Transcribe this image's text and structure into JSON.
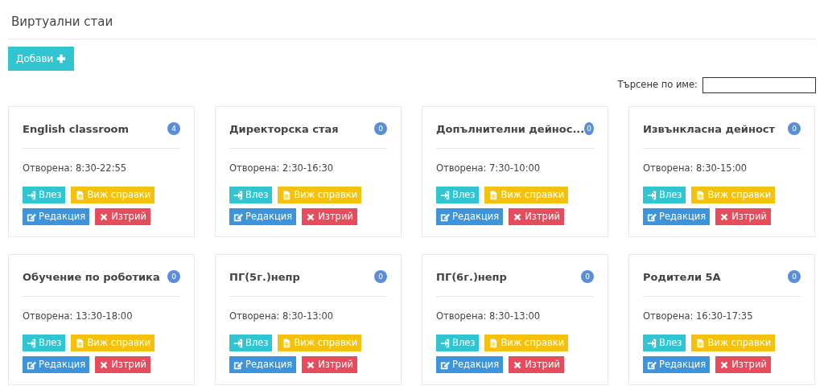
{
  "page_title": "Виртуални стаи",
  "add_button": {
    "label": "Добави"
  },
  "search": {
    "label": "Търсене по име:"
  },
  "rooms": [
    {
      "title": "English classroom",
      "count": "4",
      "hours": "Отворена: 8:30-22:55",
      "actions": [
        {
          "kind": "enter",
          "label": "Влез"
        },
        {
          "kind": "reports",
          "label": "Виж справки"
        },
        {
          "kind": "edit",
          "label": "Редакция"
        },
        {
          "kind": "delete",
          "label": "Изтрий"
        }
      ]
    },
    {
      "title": "Директорска стая",
      "count": "0",
      "hours": "Отворена: 2:30-16:30",
      "actions": [
        {
          "kind": "enter",
          "label": "Влез"
        },
        {
          "kind": "reports",
          "label": "Виж справки"
        },
        {
          "kind": "edit",
          "label": "Редакция"
        },
        {
          "kind": "delete",
          "label": "Изтрий"
        }
      ]
    },
    {
      "title": "Допълнителни дейнос...",
      "count": "0",
      "hours": "Отворена: 7:30-10:00",
      "actions": [
        {
          "kind": "enter",
          "label": "Влез"
        },
        {
          "kind": "reports",
          "label": "Виж справки"
        },
        {
          "kind": "edit",
          "label": "Редакция"
        },
        {
          "kind": "delete",
          "label": "Изтрий"
        }
      ]
    },
    {
      "title": "Извънкласна дейност",
      "count": "0",
      "hours": "Отворена: 8:30-15:00",
      "actions": [
        {
          "kind": "enter",
          "label": "Влез"
        },
        {
          "kind": "reports",
          "label": "Виж справки"
        },
        {
          "kind": "edit",
          "label": "Редакция"
        },
        {
          "kind": "delete",
          "label": "Изтрий"
        }
      ]
    },
    {
      "title": "Обучение по роботика",
      "count": "0",
      "hours": "Отворена: 13:30-18:00",
      "actions": [
        {
          "kind": "enter",
          "label": "Влез"
        },
        {
          "kind": "reports",
          "label": "Виж справки"
        },
        {
          "kind": "edit",
          "label": "Редакция"
        },
        {
          "kind": "delete",
          "label": "Изтрий"
        }
      ]
    },
    {
      "title": "ПГ(5г.)непр",
      "count": "0",
      "hours": "Отворена: 8:30-13:00",
      "actions": [
        {
          "kind": "enter",
          "label": "Влез"
        },
        {
          "kind": "reports",
          "label": "Виж справки"
        },
        {
          "kind": "edit",
          "label": "Редакция"
        },
        {
          "kind": "delete",
          "label": "Изтрий"
        }
      ]
    },
    {
      "title": "ПГ(6г.)непр",
      "count": "0",
      "hours": "Отворена: 8:30-13:00",
      "actions": [
        {
          "kind": "enter",
          "label": "Влез"
        },
        {
          "kind": "reports",
          "label": "Виж справки"
        },
        {
          "kind": "edit",
          "label": "Редакция"
        },
        {
          "kind": "delete",
          "label": "Изтрий"
        }
      ]
    },
    {
      "title": "Родители 5А",
      "count": "0",
      "hours": "Отворена: 16:30-17:35",
      "actions": [
        {
          "kind": "enter",
          "label": "Влез"
        },
        {
          "kind": "reports",
          "label": "Виж справки"
        },
        {
          "kind": "edit",
          "label": "Редакция"
        },
        {
          "kind": "delete",
          "label": "Изтрий"
        }
      ]
    }
  ]
}
